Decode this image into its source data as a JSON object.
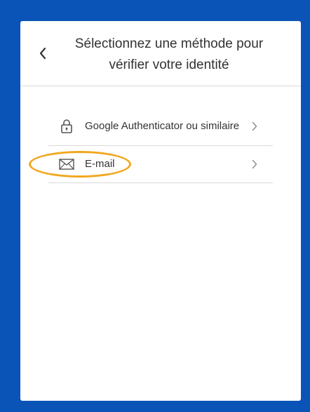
{
  "header": {
    "title": "Sélectionnez une méthode pour vérifier votre identité",
    "back_icon": "chevron-left-icon"
  },
  "methods": [
    {
      "label": "Google Authenticator ou similaire",
      "icon": "lock-icon"
    },
    {
      "label": "E-mail",
      "icon": "envelope-icon",
      "highlighted": true
    }
  ],
  "colors": {
    "background": "#0b54b7",
    "card": "#ffffff",
    "highlight": "#f1a71e",
    "divider": "#d9d9d9",
    "text": "#323232"
  }
}
